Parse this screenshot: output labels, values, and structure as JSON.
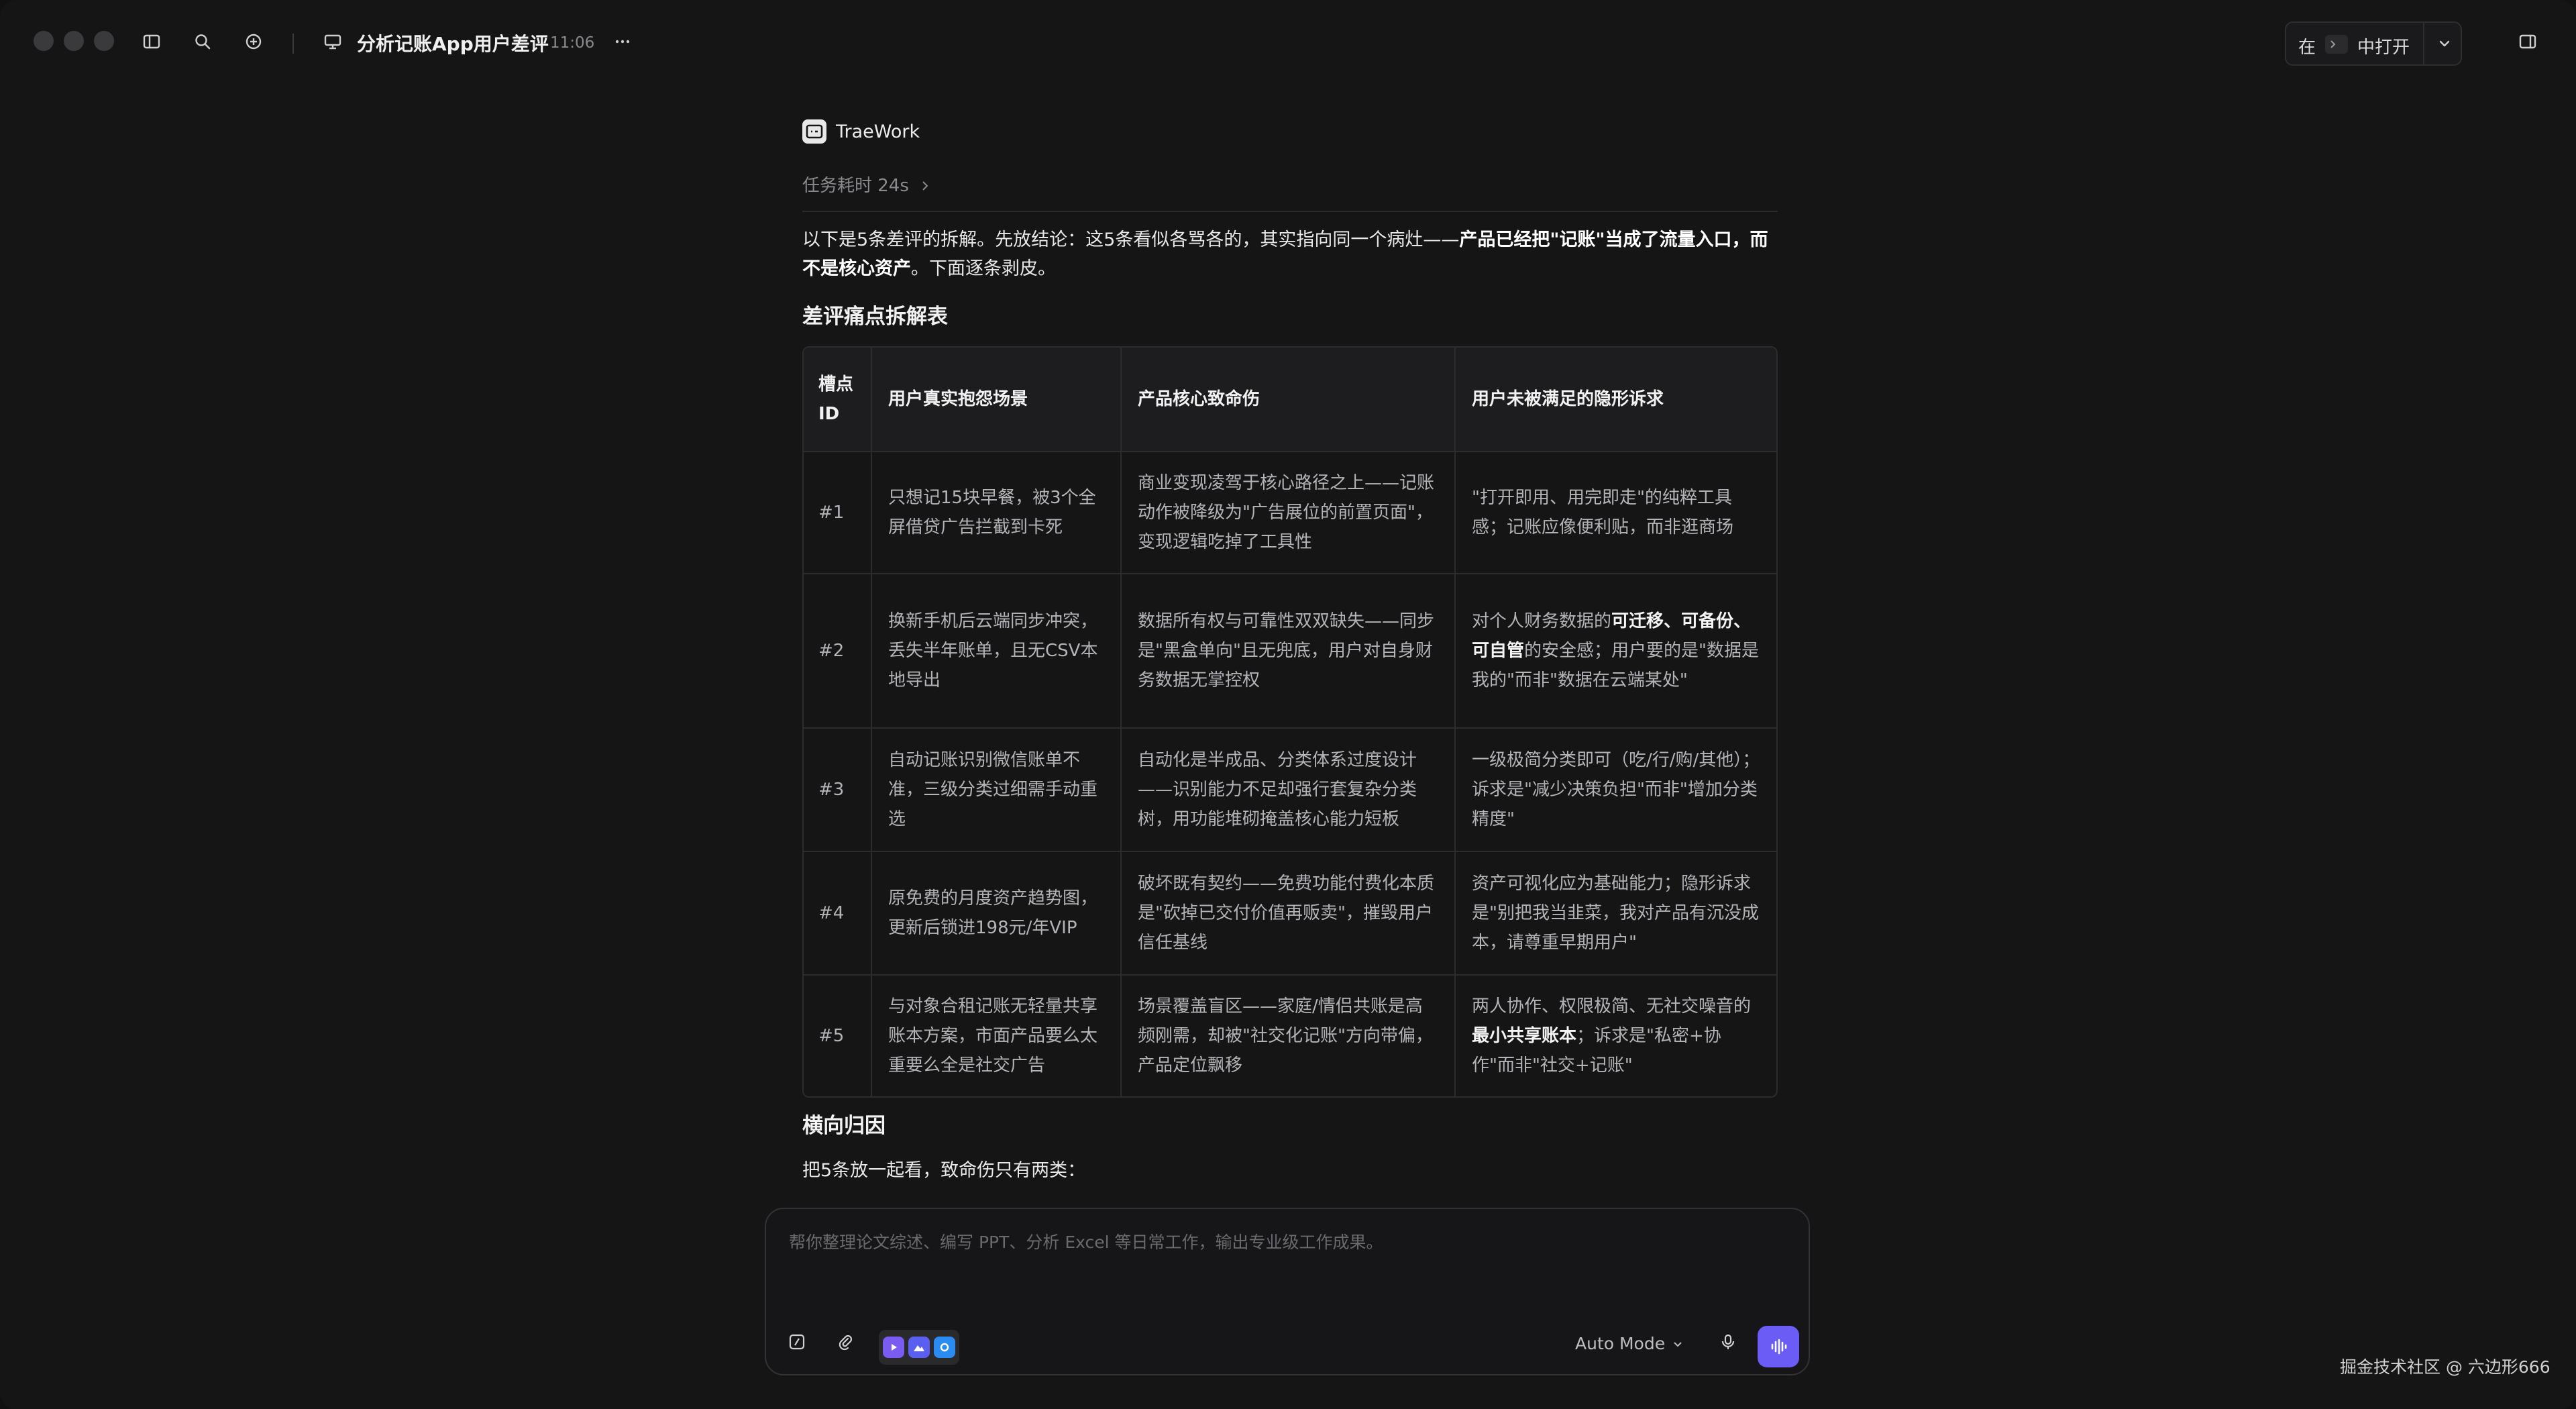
{
  "titlebar": {
    "title": "分析记账App用户差评",
    "time": "11:06",
    "open_in_prefix": "在",
    "open_in_suffix": "中打开"
  },
  "agent": {
    "name": "TraeWork",
    "duration": "任务耗时 24s"
  },
  "message": {
    "intro_plain": "以下是5条差评的拆解。先放结论：这5条看似各骂各的，其实指向同一个病灶——",
    "intro_bold": "产品已经把\"记账\"当成了流量入口，而不是核心资产",
    "intro_tail": "。下面逐条剥皮。",
    "section_title": "差评痛点拆解表",
    "table": {
      "headers": [
        "槽点ID",
        "用户真实抱怨场景",
        "产品核心致命伤",
        "用户未被满足的隐形诉求"
      ],
      "rows": [
        {
          "id": "#1",
          "scene": "只想记15块早餐，被3个全屏借贷广告拦截到卡死",
          "wound": "商业变现凌驾于核心路径之上——记账动作被降级为\"广告展位的前置页面\"，变现逻辑吃掉了工具性",
          "need_pre": "\"打开即用、用完即走\"的纯粹工具感；记账应像便利贴，而非逛商场",
          "need_bold": "",
          "need_post": ""
        },
        {
          "id": "#2",
          "scene": "换新手机后云端同步冲突，丢失半年账单，且无CSV本地导出",
          "wound": "数据所有权与可靠性双双缺失——同步是\"黑盒单向\"且无兜底，用户对自身财务数据无掌控权",
          "need_pre": "对个人财务数据的",
          "need_bold": "可迁移、可备份、可自管",
          "need_post": "的安全感；用户要的是\"数据是我的\"而非\"数据在云端某处\""
        },
        {
          "id": "#3",
          "scene": "自动记账识别微信账单不准，三级分类过细需手动重选",
          "wound": "自动化是半成品、分类体系过度设计——识别能力不足却强行套复杂分类树，用功能堆砌掩盖核心能力短板",
          "need_pre": "一级极简分类即可（吃/行/购/其他）；诉求是\"减少决策负担\"而非\"增加分类精度\"",
          "need_bold": "",
          "need_post": ""
        },
        {
          "id": "#4",
          "scene": "原免费的月度资产趋势图，更新后锁进198元/年VIP",
          "wound": "破坏既有契约——免费功能付费化本质是\"砍掉已交付价值再贩卖\"，摧毁用户信任基线",
          "need_pre": "资产可视化应为基础能力；隐形诉求是\"别把我当韭菜，我对产品有沉没成本，请尊重早期用户\"",
          "need_bold": "",
          "need_post": ""
        },
        {
          "id": "#5",
          "scene": "与对象合租记账无轻量共享账本方案，市面产品要么太重要么全是社交广告",
          "wound": "场景覆盖盲区——家庭/情侣共账是高频刚需，却被\"社交化记账\"方向带偏，产品定位飘移",
          "need_pre": "两人协作、权限极简、无社交噪音的",
          "need_bold": "最小共享账本",
          "need_post": "；诉求是\"私密+协作\"而非\"社交+记账\""
        }
      ]
    },
    "section2_title": "横向归因",
    "section2_line": "把5条放一起看，致命伤只有两类："
  },
  "composer": {
    "placeholder": "帮你整理论文综述、编写 PPT、分析 Excel 等日常工作，输出专业级工作成果。",
    "mode": "Auto Mode"
  },
  "watermark": "掘金技术社区 @ 六边形666",
  "colors": {
    "accent": "#6a5cf5",
    "background": "#151516"
  }
}
